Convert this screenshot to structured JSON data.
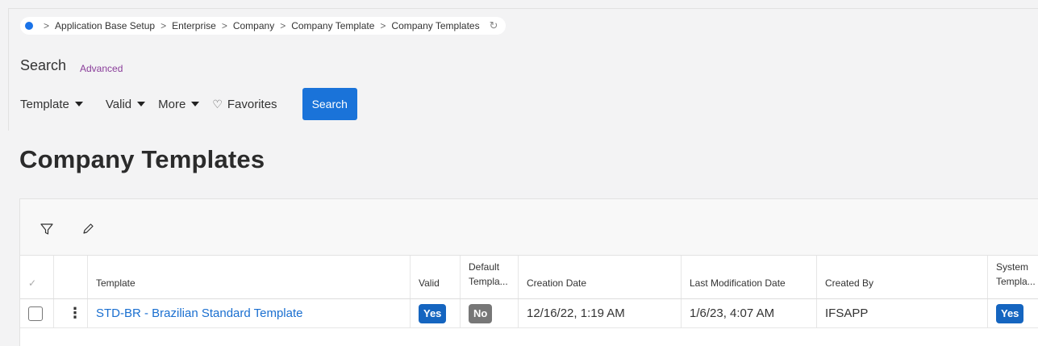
{
  "breadcrumb": {
    "items": [
      "Application Base Setup",
      "Enterprise",
      "Company",
      "Company Template",
      "Company Templates"
    ]
  },
  "search": {
    "label": "Search",
    "advanced_label": "Advanced",
    "filters": [
      {
        "label": "Template"
      },
      {
        "label": "Valid"
      },
      {
        "label": "More"
      }
    ],
    "favorites_label": "Favorites",
    "search_button_label": "Search"
  },
  "page": {
    "title": "Company Templates"
  },
  "table": {
    "headers": {
      "template": "Template",
      "valid": "Valid",
      "default_template_1": "Default",
      "default_template_2": "Templa...",
      "creation_date": "Creation Date",
      "last_modification_date": "Last Modification Date",
      "created_by": "Created By",
      "system_template_1": "System",
      "system_template_2": "Templa..."
    },
    "rows": [
      {
        "template": "STD-BR - Brazilian Standard Template",
        "valid": "Yes",
        "default_template": "No",
        "creation_date": "12/16/22, 1:19 AM",
        "last_modification_date": "1/6/23, 4:07 AM",
        "created_by": "IFSAPP",
        "system_template": "Yes"
      }
    ]
  },
  "colors": {
    "accent": "#1a73d9",
    "badge_yes": "#1565c0",
    "badge_no": "#777777",
    "advanced_link": "#8a3d9a",
    "link": "#1a6fd0"
  }
}
